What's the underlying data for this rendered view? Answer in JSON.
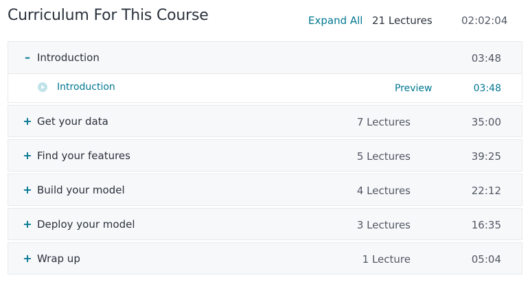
{
  "header": {
    "title": "Curriculum For This Course",
    "expand_all": "Expand All",
    "total_lectures": "21 Lectures",
    "total_duration": "02:02:04"
  },
  "sections": [
    {
      "toggle": "–",
      "title": "Introduction",
      "count": "",
      "duration": "03:48",
      "expanded": true,
      "lectures": [
        {
          "icon": "play-circle-icon",
          "title": "Introduction",
          "preview": "Preview",
          "duration": "03:48"
        }
      ]
    },
    {
      "toggle": "+",
      "title": "Get your data",
      "count": "7 Lectures",
      "duration": "35:00",
      "expanded": false
    },
    {
      "toggle": "+",
      "title": "Find your features",
      "count": "5 Lectures",
      "duration": "39:25",
      "expanded": false
    },
    {
      "toggle": "+",
      "title": "Build your model",
      "count": "4 Lectures",
      "duration": "22:12",
      "expanded": false
    },
    {
      "toggle": "+",
      "title": "Deploy your model",
      "count": "3 Lectures",
      "duration": "16:35",
      "expanded": false
    },
    {
      "toggle": "+",
      "title": "Wrap up",
      "count": "1 Lecture",
      "duration": "05:04",
      "expanded": false
    }
  ],
  "colors": {
    "accent": "#007791",
    "text": "#29303b",
    "muted": "#505763",
    "section_bg": "#f7f8fa",
    "border": "#e8e9eb"
  }
}
